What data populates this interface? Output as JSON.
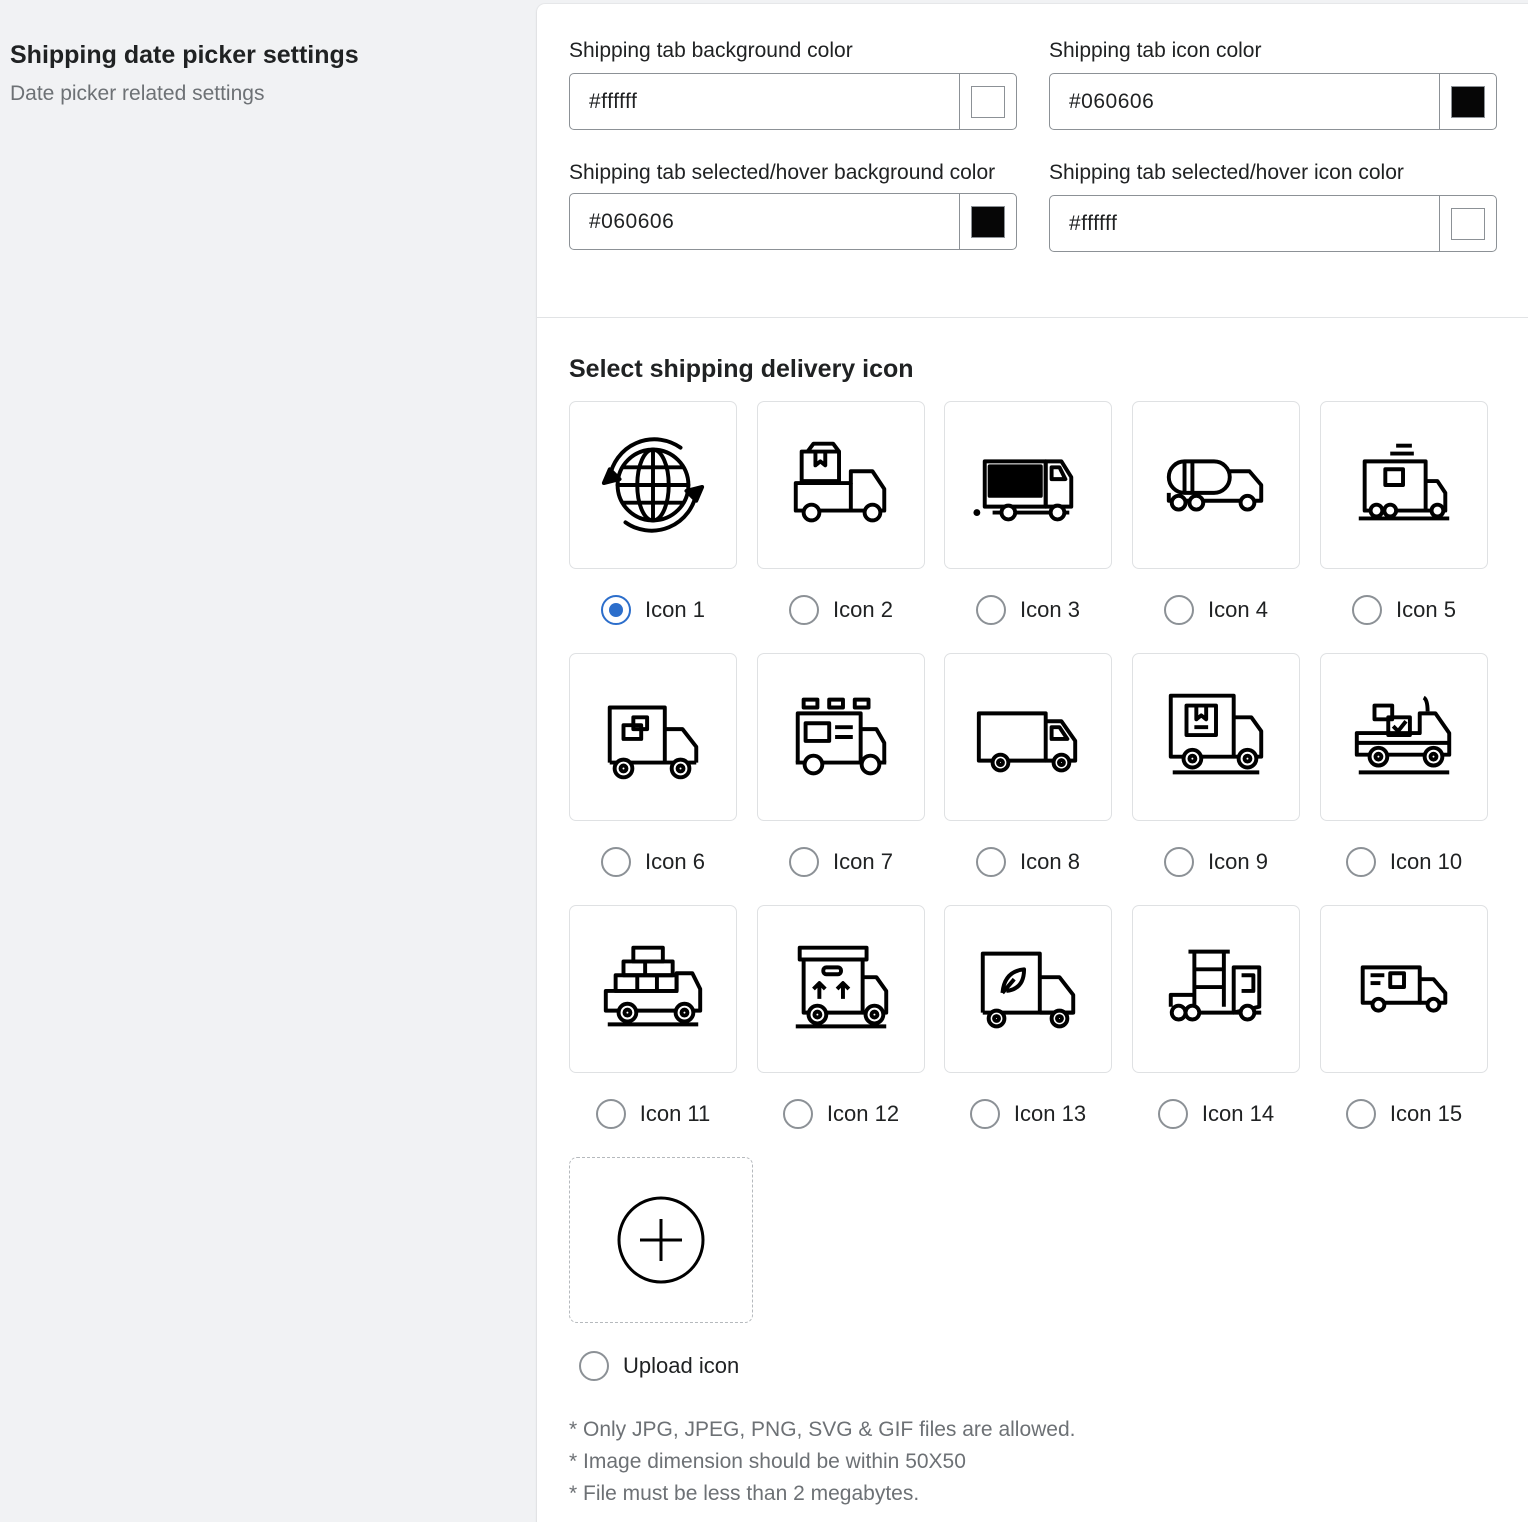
{
  "section": {
    "title": "Shipping date picker settings",
    "subtitle": "Date picker related settings"
  },
  "colors": {
    "tab_bg": {
      "label": "Shipping tab background color",
      "value": "#ffffff",
      "swatch": "#ffffff"
    },
    "tab_icon": {
      "label": "Shipping tab icon color",
      "value": "#060606",
      "swatch": "#060606"
    },
    "tab_hover_bg": {
      "label": "Shipping tab selected/hover background color",
      "value": "#060606",
      "swatch": "#060606"
    },
    "tab_hover_icon": {
      "label": "Shipping tab selected/hover icon color",
      "value": "#ffffff",
      "swatch": "#ffffff"
    }
  },
  "icon_picker": {
    "heading": "Select shipping delivery icon",
    "selected": "Icon 1",
    "icons": [
      {
        "label": "Icon 1",
        "glyph": "globe-refresh-icon"
      },
      {
        "label": "Icon 2",
        "glyph": "pickup-box-icon"
      },
      {
        "label": "Icon 3",
        "glyph": "fast-truck-icon"
      },
      {
        "label": "Icon 4",
        "glyph": "tanker-truck-icon"
      },
      {
        "label": "Icon 5",
        "glyph": "cargo-truck-icon"
      },
      {
        "label": "Icon 6",
        "glyph": "box-truck-icon"
      },
      {
        "label": "Icon 7",
        "glyph": "food-truck-icon"
      },
      {
        "label": "Icon 8",
        "glyph": "van-truck-icon"
      },
      {
        "label": "Icon 9",
        "glyph": "package-truck-icon"
      },
      {
        "label": "Icon 10",
        "glyph": "pickup-check-icon"
      },
      {
        "label": "Icon 11",
        "glyph": "stacked-boxes-truck-icon"
      },
      {
        "label": "Icon 12",
        "glyph": "this-side-up-truck-icon"
      },
      {
        "label": "Icon 13",
        "glyph": "eco-truck-icon"
      },
      {
        "label": "Icon 14",
        "glyph": "rack-truck-icon"
      },
      {
        "label": "Icon 15",
        "glyph": "express-truck-icon"
      }
    ],
    "upload_label": "Upload icon"
  },
  "notes": [
    "* Only JPG, JPEG, PNG, SVG & GIF files are allowed.",
    "* Image dimension should be within 50X50",
    "* File must be less than 2 megabytes."
  ]
}
